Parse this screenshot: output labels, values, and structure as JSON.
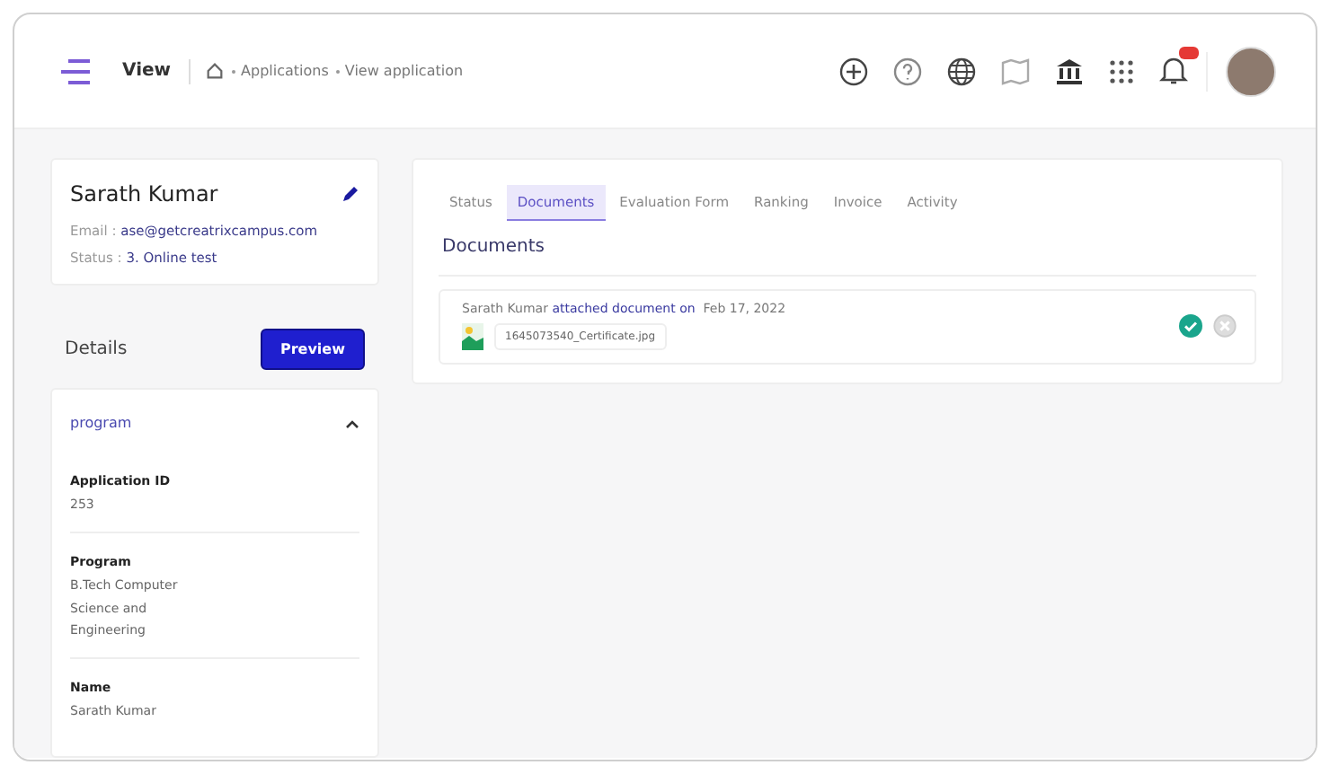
{
  "header": {
    "title": "View",
    "breadcrumb": [
      "Applications",
      "View application"
    ]
  },
  "profile": {
    "name": "Sarath Kumar",
    "email_label": "Email :",
    "email": "ase@getcreatrixcampus.com",
    "status_label": "Status :",
    "status": "3. Online test"
  },
  "details": {
    "title": "Details",
    "preview_button": "Preview",
    "section": {
      "title": "program",
      "expanded": true,
      "fields": [
        {
          "label": "Application ID",
          "value": "253"
        },
        {
          "label": "Program",
          "value": "B.Tech Computer Science and Engineering"
        },
        {
          "label": "Name",
          "value": "Sarath Kumar"
        }
      ]
    }
  },
  "tabs": [
    {
      "label": "Status",
      "selected": false
    },
    {
      "label": "Documents",
      "selected": true
    },
    {
      "label": "Evaluation Form",
      "selected": false
    },
    {
      "label": "Ranking",
      "selected": false
    },
    {
      "label": "Invoice",
      "selected": false
    },
    {
      "label": "Activity",
      "selected": false
    }
  ],
  "documents": {
    "title": "Documents",
    "items": [
      {
        "author": "Sarath Kumar",
        "action": "attached document on",
        "date": "Feb 17, 2022",
        "file": "1645073540_Certificate.jpg",
        "approved": true
      }
    ]
  }
}
